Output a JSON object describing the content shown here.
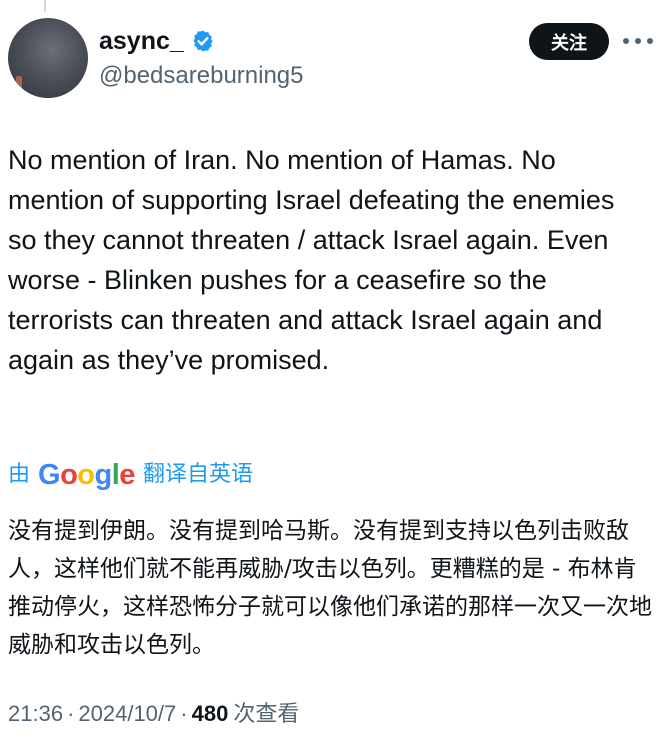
{
  "author": {
    "display_name": "async_",
    "handle": "@bedsareburning5",
    "verified": true
  },
  "actions": {
    "follow_label": "关注",
    "more_icon": "more-horizontal-icon"
  },
  "tweet": {
    "text": "No mention of Iran. No mention of Hamas. No mention of supporting Israel defeating the enemies so they cannot threaten / attack Israel again. Even worse - Blinken pushes for a ceasefire so the terrorists can threaten and attack Israel again and again as they’ve promised."
  },
  "translation": {
    "prefix": "由",
    "logo_text": "Google",
    "suffix": "翻译自英语",
    "text": "没有提到伊朗。没有提到哈马斯。没有提到支持以色列击败敌人，这样他们就不能再威胁/攻击以色列。更糟糕的是 - 布林肯推动停火，这样恐怖分子就可以像他们承诺的那样一次又一次地威胁和攻击以色列。"
  },
  "meta": {
    "time": "21:36",
    "separator": "·",
    "date": "2024/10/7",
    "views_count": "480",
    "views_label": "次查看"
  },
  "colors": {
    "link_blue": "#1d9bf0",
    "verified_blue": "#1d9bf0",
    "secondary_text": "#536471",
    "primary_text": "#0f1419"
  }
}
